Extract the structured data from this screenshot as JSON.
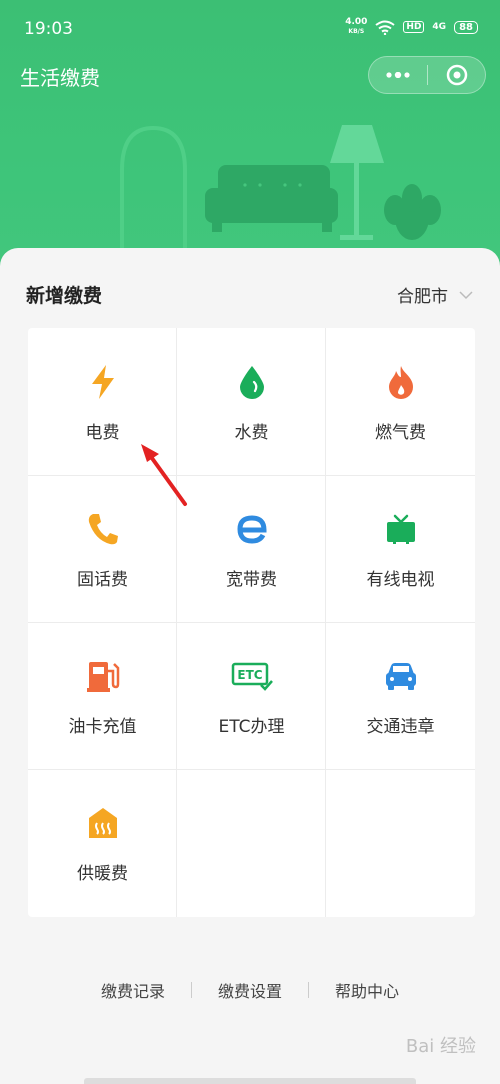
{
  "status": {
    "time": "19:03",
    "net_speed": "4.00",
    "net_unit": "KB/S",
    "hd": "HD",
    "signal": "4G",
    "battery": "88"
  },
  "header": {
    "title": "生活缴费"
  },
  "section": {
    "title": "新增缴费",
    "city": "合肥市"
  },
  "services": [
    {
      "label": "电费",
      "icon": "lightning-icon",
      "color": "#f5a623"
    },
    {
      "label": "水费",
      "icon": "water-drop-icon",
      "color": "#1aad5a"
    },
    {
      "label": "燃气费",
      "icon": "flame-icon",
      "color": "#f06a3b"
    },
    {
      "label": "固话费",
      "icon": "phone-icon",
      "color": "#f5a623"
    },
    {
      "label": "宽带费",
      "icon": "broadband-e-icon",
      "color": "#2f8be0"
    },
    {
      "label": "有线电视",
      "icon": "tv-icon",
      "color": "#1aad5a"
    },
    {
      "label": "油卡充值",
      "icon": "fuel-pump-icon",
      "color": "#f06a3b"
    },
    {
      "label": "ETC办理",
      "icon": "etc-icon",
      "color": "#1aad5a"
    },
    {
      "label": "交通违章",
      "icon": "car-icon",
      "color": "#2f8be0"
    },
    {
      "label": "供暖费",
      "icon": "heating-icon",
      "color": "#f5a623"
    }
  ],
  "footer": {
    "records": "缴费记录",
    "settings": "缴费设置",
    "help": "帮助中心"
  },
  "watermark": "Bai 经验"
}
